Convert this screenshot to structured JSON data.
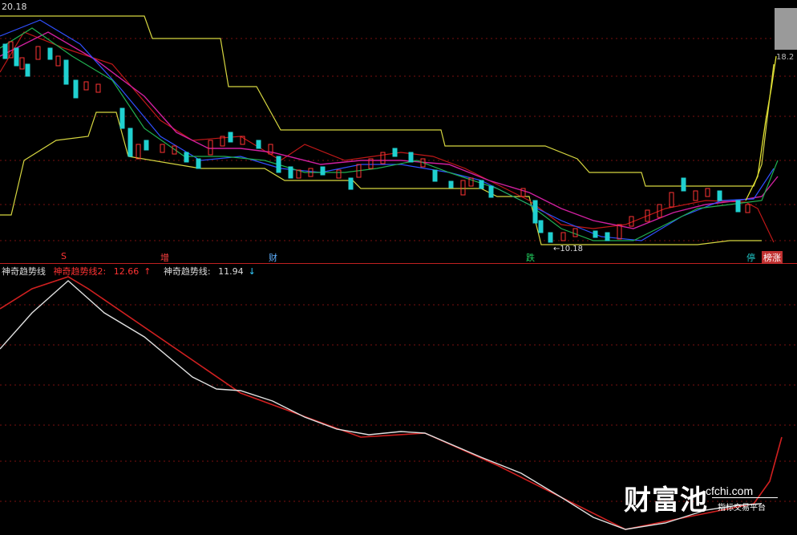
{
  "price_top": "20.18",
  "price_right": "18.2",
  "low_price": "10.18",
  "markers": {
    "s": "S",
    "zeng": "增",
    "cai": "财",
    "die": "跌",
    "ting": "停",
    "zhang": "涨"
  },
  "indicator": {
    "name": "神奇趋势线",
    "line2_label": "神奇趋势线2:",
    "line2_value": "12.66",
    "line2_arrow": "↑",
    "line1_label": "神奇趋势线:",
    "line1_value": "11.94",
    "line1_arrow": "↓"
  },
  "watermark": {
    "brand": "财富池",
    "url": "cfchi.com",
    "tagline": "指标交易平台"
  },
  "colors": {
    "up": "#ff3333",
    "down": "#22d0d0",
    "band": "#d6d640",
    "trend_white": "#e0e0e0",
    "trend_red": "#d02020"
  }
}
